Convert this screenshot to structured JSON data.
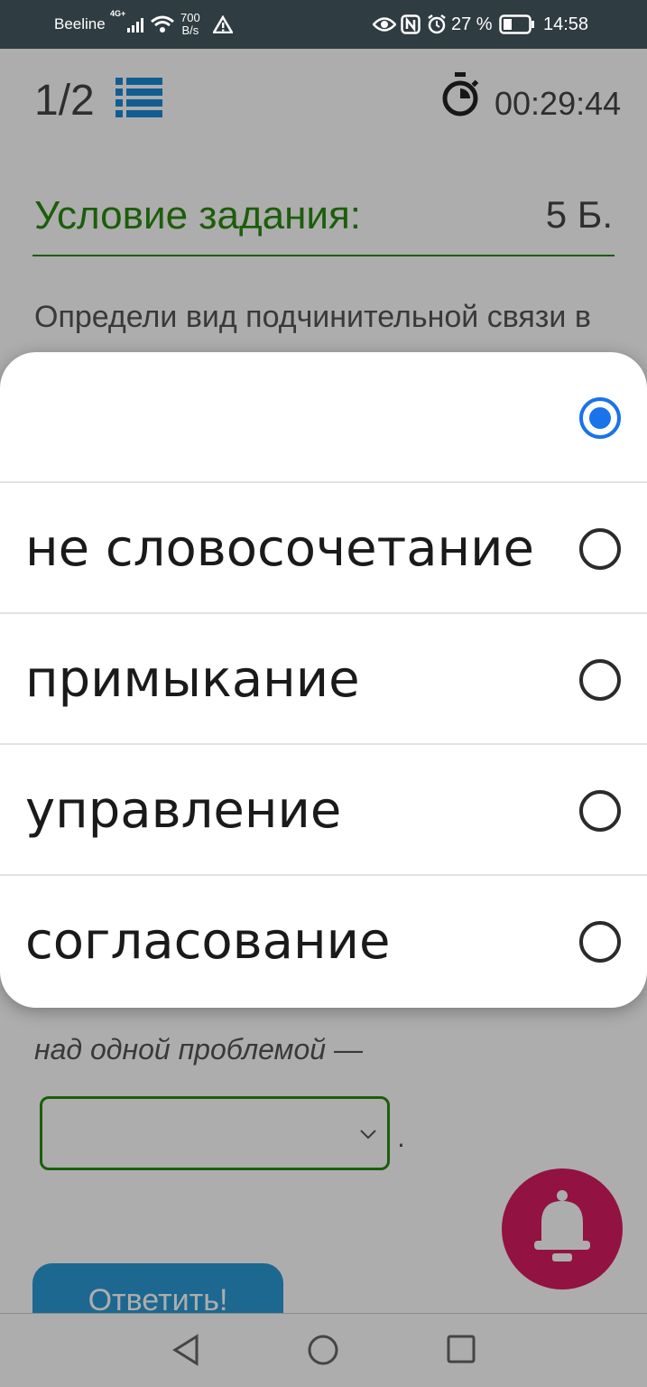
{
  "status_bar": {
    "carrier": "Beeline",
    "network_type": "4G+",
    "speed_value": "700",
    "speed_unit": "B/s",
    "battery_percent": "27 %",
    "time": "14:58"
  },
  "header": {
    "question_counter": "1/2",
    "timer": "00:29:44"
  },
  "task": {
    "condition_label": "Условие задания:",
    "points": "5 Б.",
    "text": "Определи вид подчинительной связи в",
    "phrase": "над одной проблемой —",
    "select_value": "",
    "period": "."
  },
  "buttons": {
    "answer_label": "Ответить!"
  },
  "dropdown": {
    "options": [
      {
        "label": "",
        "selected": true
      },
      {
        "label": "не словосочетание",
        "selected": false
      },
      {
        "label": "примыкание",
        "selected": false
      },
      {
        "label": "управление",
        "selected": false
      },
      {
        "label": "согласование",
        "selected": false
      }
    ]
  },
  "colors": {
    "accent_green": "#2a8a10",
    "accent_blue": "#1a73e8",
    "button_blue": "#2b9ad6",
    "fab_pink": "#d81b60",
    "status_bar": "#2f3c41"
  },
  "icons": [
    "list-icon",
    "stopwatch-icon",
    "bell-icon",
    "chevron-down-icon",
    "back-nav-icon",
    "home-nav-icon",
    "recents-nav-icon"
  ]
}
